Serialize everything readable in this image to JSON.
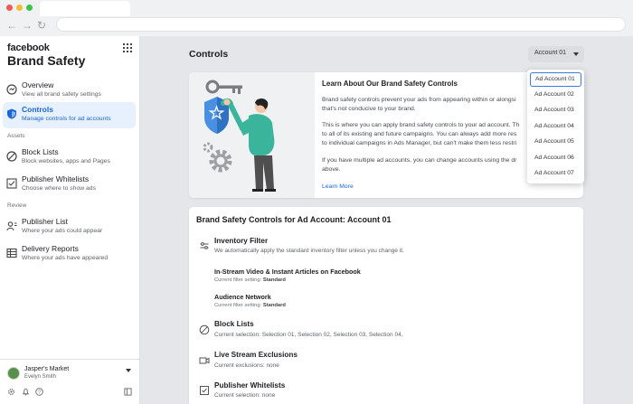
{
  "sidebar": {
    "logo": "facebook",
    "app_title": "Brand Safety",
    "nav": [
      {
        "title": "Overview",
        "sub": "View all brand safety settings",
        "icon": "overview-icon"
      },
      {
        "title": "Controls",
        "sub": "Manage controls for ad accounts",
        "icon": "shield-icon",
        "active": true
      },
      {
        "title": "Block Lists",
        "sub": "Block websites, apps and Pages",
        "icon": "block-icon"
      },
      {
        "title": "Publisher Whitelists",
        "sub": "Choose where to show ads",
        "icon": "checklist-icon"
      },
      {
        "title": "Publisher List",
        "sub": "Where your ads could appear",
        "icon": "list-icon"
      },
      {
        "title": "Delivery Reports",
        "sub": "Where your ads have appeared",
        "icon": "table-icon"
      }
    ],
    "sections": {
      "assets": "Assets",
      "review": "Review"
    },
    "account": {
      "name": "Jasper's Market",
      "user": "Evelyn Smith"
    }
  },
  "header": {
    "page_title": "Controls",
    "account_button": "Account 01"
  },
  "learn_card": {
    "title": "Learn About Our Brand Safety Controls",
    "p1a": "Brand safety controls prevent your ads from appearing within or alongsi",
    "p1b": "that's not conducive to your brand.",
    "p2a": "This is where you can apply brand safety controls to your ad account. Th",
    "p2b": "to all of its existing and future campaigns. You can always add more res",
    "p2c": "to individual campaigns in Ads Manager, but can't make them less restri",
    "p3a": "If you have multiple ad accounts, you can change accounts using the dr",
    "p3b": "above.",
    "learn_more": "Learn More"
  },
  "controls_card": {
    "title": "Brand Safety Controls for Ad Account: Account 01",
    "inventory": {
      "title": "Inventory Filter",
      "sub": "We automatically apply the standard inventory filter unless you change it.",
      "instream_title": "In-Stream Video & Instant Articles on Facebook",
      "audience_title": "Audience Network",
      "setting_label": "Current filter setting:",
      "setting_value": "Standard"
    },
    "block_lists": {
      "title": "Block Lists",
      "sub": "Current selection: Selection 01, Selection 02, Selection 03, Selection 04,"
    },
    "live_stream": {
      "title": "Live Stream Exclusions",
      "sub": "Current exclusions: none"
    },
    "whitelists": {
      "title": "Publisher Whitelists",
      "sub": "Current selection: none"
    }
  },
  "dropdown": {
    "items": [
      "Ad Account 01",
      "Ad Account 02",
      "Ad Account 03",
      "Ad Account 04",
      "Ad Account 05",
      "Ad Account 06",
      "Ad Account 07"
    ],
    "selected": "Ad Account 01"
  },
  "colors": {
    "accent": "#1967d2",
    "illustration_teal": "#3ab59c",
    "shield_blue": "#4a90e2"
  }
}
